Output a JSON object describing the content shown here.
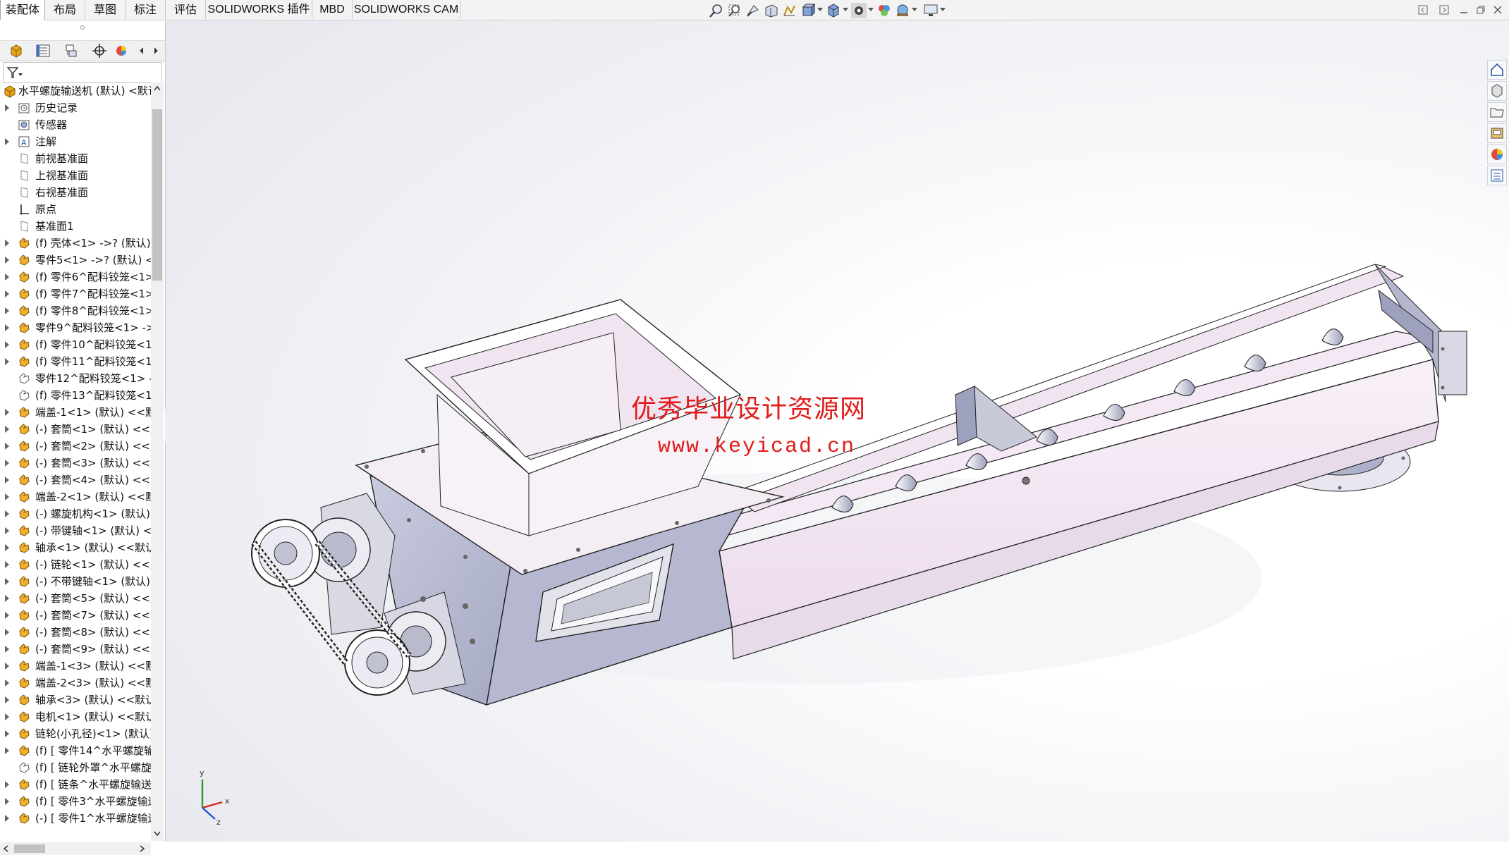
{
  "command_tabs": [
    {
      "label": "装配体",
      "active": true
    },
    {
      "label": "布局"
    },
    {
      "label": "草图"
    },
    {
      "label": "标注"
    },
    {
      "label": "评估"
    },
    {
      "label": "SOLIDWORKS 插件"
    },
    {
      "label": "MBD"
    },
    {
      "label": "SOLIDWORKS CAM"
    }
  ],
  "heads_up_toolbar": [
    "zoom-to-fit-icon",
    "zoom-to-area-icon",
    "previous-view-icon",
    "section-view-icon",
    "dynamic-annotation-icon",
    "view-orientation-icon",
    "display-style-icon",
    "hide-show-items-icon",
    "edit-appearance-icon",
    "apply-scene-icon",
    "view-settings-icon"
  ],
  "panel_tabs": [
    "featuremanager-icon",
    "propertymanager-icon",
    "configurationmanager-icon",
    "dimxpert-icon",
    "display-manager-icon"
  ],
  "tree": {
    "root": "水平螺旋输送机 (默认) <默认",
    "items": [
      {
        "label": "历史记录",
        "icon": "history-icon",
        "expand": true
      },
      {
        "label": "传感器",
        "icon": "sensor-icon",
        "expand": false
      },
      {
        "label": "注解",
        "icon": "annotation-icon",
        "expand": true
      },
      {
        "label": "前视基准面",
        "icon": "plane-icon",
        "expand": false
      },
      {
        "label": "上视基准面",
        "icon": "plane-icon",
        "expand": false
      },
      {
        "label": "右视基准面",
        "icon": "plane-icon",
        "expand": false
      },
      {
        "label": "原点",
        "icon": "origin-icon",
        "expand": false
      },
      {
        "label": "基准面1",
        "icon": "plane-icon",
        "expand": false
      },
      {
        "label": "(f) 壳体<1> ->? (默认) <",
        "icon": "part-icon",
        "expand": true
      },
      {
        "label": "零件5<1> ->? (默认) <<",
        "icon": "part-icon",
        "expand": true
      },
      {
        "label": "(f) 零件6^配料铰笼<1>",
        "icon": "part-icon",
        "expand": true
      },
      {
        "label": "(f) 零件7^配料铰笼<1>",
        "icon": "part-icon",
        "expand": true
      },
      {
        "label": "(f) 零件8^配料铰笼<1>",
        "icon": "part-icon",
        "expand": true
      },
      {
        "label": "零件9^配料铰笼<1> ->",
        "icon": "part-icon",
        "expand": true
      },
      {
        "label": "(f) 零件10^配料铰笼<1:",
        "icon": "part-icon",
        "expand": true
      },
      {
        "label": "(f) 零件11^配料铰笼<1:",
        "icon": "part-icon",
        "expand": true
      },
      {
        "label": "零件12^配料铰笼<1> -",
        "icon": "part-outline-icon",
        "expand": false
      },
      {
        "label": "(f) 零件13^配料铰笼<1:",
        "icon": "part-outline-icon",
        "expand": false
      },
      {
        "label": "端盖-1<1> (默认) <<默",
        "icon": "part-icon",
        "expand": true
      },
      {
        "label": "(-) 套筒<1> (默认) <<默",
        "icon": "part-icon",
        "expand": true
      },
      {
        "label": "(-) 套筒<2> (默认) <<默",
        "icon": "part-icon",
        "expand": true
      },
      {
        "label": "(-) 套筒<3> (默认) <<默",
        "icon": "part-icon",
        "expand": true
      },
      {
        "label": "(-) 套筒<4> (默认) <<默",
        "icon": "part-icon",
        "expand": true
      },
      {
        "label": "端盖-2<1> (默认) <<默",
        "icon": "part-icon",
        "expand": true
      },
      {
        "label": "(-) 螺旋机构<1> (默认)",
        "icon": "part-icon",
        "expand": true
      },
      {
        "label": "(-) 带键轴<1> (默认) <<",
        "icon": "part-icon",
        "expand": true
      },
      {
        "label": "轴承<1> (默认) <<默认",
        "icon": "part-icon",
        "expand": true
      },
      {
        "label": "(-) 链轮<1> (默认) <<默",
        "icon": "part-icon",
        "expand": true
      },
      {
        "label": "(-) 不带键轴<1> (默认)",
        "icon": "part-icon",
        "expand": true
      },
      {
        "label": "(-) 套筒<5> (默认) <<默",
        "icon": "part-icon",
        "expand": true
      },
      {
        "label": "(-) 套筒<7> (默认) <<默",
        "icon": "part-icon",
        "expand": true
      },
      {
        "label": "(-) 套筒<8> (默认) <<默",
        "icon": "part-icon",
        "expand": true
      },
      {
        "label": "(-) 套筒<9> (默认) <<默",
        "icon": "part-icon",
        "expand": true
      },
      {
        "label": "端盖-1<3> (默认) <<默",
        "icon": "part-icon",
        "expand": true
      },
      {
        "label": "端盖-2<3> (默认) <<默",
        "icon": "part-icon",
        "expand": true
      },
      {
        "label": "轴承<3> (默认) <<默认",
        "icon": "part-icon",
        "expand": true
      },
      {
        "label": "电机<1> (默认) <<默认",
        "icon": "part-icon",
        "expand": true
      },
      {
        "label": "链轮(小孔径)<1> (默认)",
        "icon": "part-icon",
        "expand": true
      },
      {
        "label": "(f) [ 零件14^水平螺旋输",
        "icon": "part-icon",
        "expand": true
      },
      {
        "label": "(f) [ 链轮外罩^水平螺旋",
        "icon": "part-outline-icon",
        "expand": false
      },
      {
        "label": "(f) [ 链条^水平螺旋输送",
        "icon": "part-icon",
        "expand": true
      },
      {
        "label": "(f) [ 零件3^水平螺旋输送",
        "icon": "part-icon",
        "expand": true
      },
      {
        "label": "(-) [ 零件1^水平螺旋输送",
        "icon": "part-icon",
        "expand": true
      }
    ]
  },
  "watermark": {
    "line1": "优秀毕业设计资源网",
    "line2": "www.keyicad.cn"
  },
  "triad": {
    "x": "x",
    "y": "y",
    "z": "z"
  },
  "task_pane": [
    "home-icon",
    "design-library-icon",
    "file-explorer-icon",
    "view-palette-icon",
    "appearances-icon",
    "custom-properties-icon"
  ],
  "colors": {
    "accent_blue": "#2060c8",
    "part_icon": "#e8a317",
    "model_pink": "#f4e9f5",
    "model_steel": "#b9bdd6",
    "watermark_red": "#e21a1a"
  }
}
